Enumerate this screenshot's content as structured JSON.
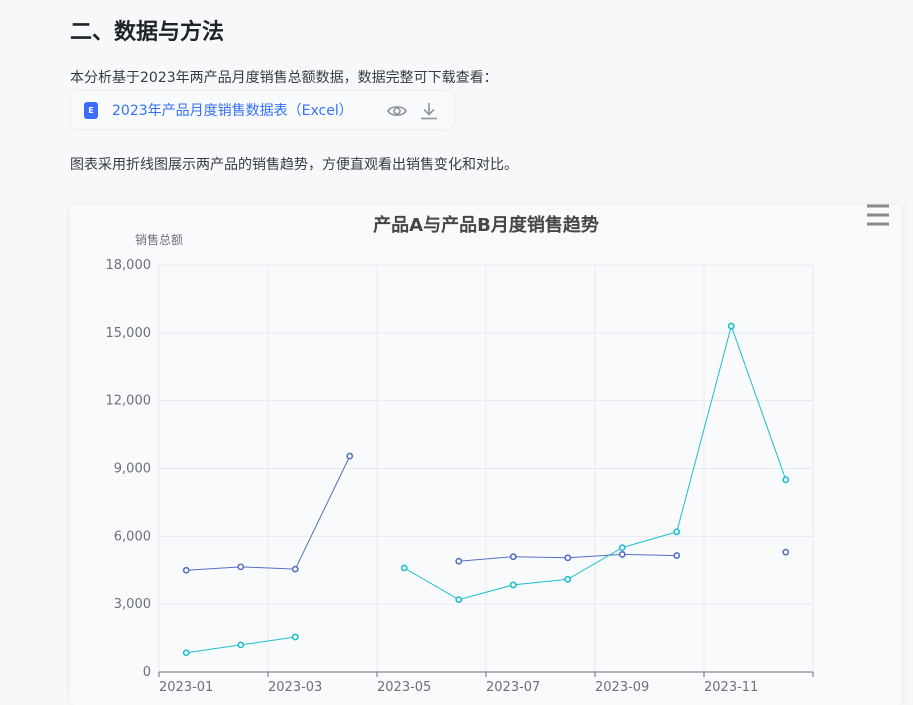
{
  "section": {
    "title": "二、数据与方法",
    "intro": "本分析基于2023年两产品月度销售总额数据，数据完整可下载查看：",
    "description": "图表采用折线图展示两产品的销售趋势，方便直观看出销售变化和对比。"
  },
  "file": {
    "name": "2023年产品月度销售数据表（Excel）",
    "icon": "excel-file-icon",
    "icon_letter": "E",
    "actions": [
      "eye-icon",
      "download-icon"
    ]
  },
  "chart_data": {
    "type": "line",
    "title": "产品A与产品B月度销售趋势",
    "ylabel": "销售总额",
    "xlabel": "",
    "x": [
      "2023-01",
      "2023-02",
      "2023-03",
      "2023-04",
      "2023-05",
      "2023-06",
      "2023-07",
      "2023-08",
      "2023-09",
      "2023-10",
      "2023-11",
      "2023-12"
    ],
    "xtick_labels": [
      "2023-01",
      "2023-03",
      "2023-05",
      "2023-07",
      "2023-09",
      "2023-11"
    ],
    "ylim": [
      0,
      18000
    ],
    "yticks": [
      0,
      3000,
      6000,
      9000,
      12000,
      15000,
      18000
    ],
    "ytick_labels": [
      "0",
      "3,000",
      "6,000",
      "9,000",
      "12,000",
      "15,000",
      "18,000"
    ],
    "grid": true,
    "series": [
      {
        "values": [
          4500,
          4650,
          4550,
          9550,
          null,
          4900,
          5100,
          5050,
          5200,
          5150,
          null,
          5300
        ],
        "color": "#5470c6"
      },
      {
        "values": [
          850,
          1200,
          1550,
          null,
          4600,
          3200,
          3850,
          4100,
          5500,
          6200,
          15300,
          8500
        ],
        "color": "#1cbfcf"
      }
    ]
  },
  "colors": {
    "axis": "#6e7079",
    "grid": "#e6e9f2",
    "title": "#464646",
    "link": "#3370ff"
  }
}
